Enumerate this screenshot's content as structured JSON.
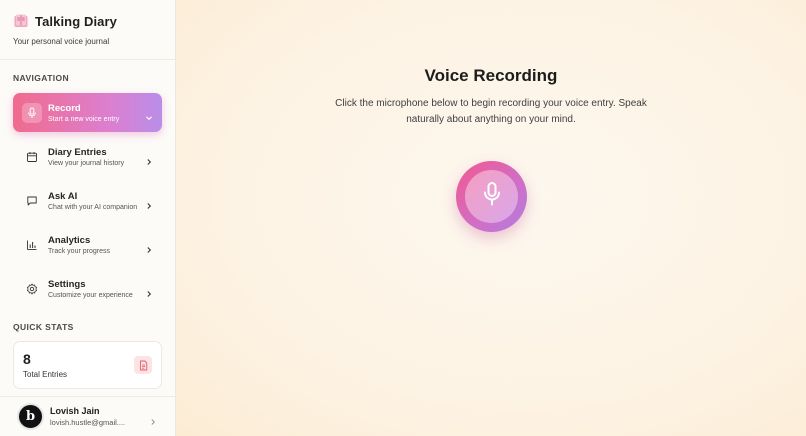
{
  "brand": {
    "title": "Talking Diary",
    "subtitle": "Your personal voice journal",
    "logo_icon": "book-icon"
  },
  "navigation": {
    "title": "NAVIGATION",
    "items": [
      {
        "label": "Record",
        "description": "Start a new voice entry",
        "icon": "microphone-icon",
        "active": true
      },
      {
        "label": "Diary Entries",
        "description": "View your journal history",
        "icon": "calendar-icon",
        "active": false
      },
      {
        "label": "Ask AI",
        "description": "Chat with your AI companion",
        "icon": "chat-icon",
        "active": false
      },
      {
        "label": "Analytics",
        "description": "Track your progress",
        "icon": "bar-chart-icon",
        "active": false
      },
      {
        "label": "Settings",
        "description": "Customize your experience",
        "icon": "gear-icon",
        "active": false
      }
    ]
  },
  "quick_stats": {
    "title": "QUICK STATS",
    "total_entries_value": "8",
    "total_entries_label": "Total Entries",
    "icon": "document-icon"
  },
  "user": {
    "name": "Lovish Jain",
    "email": "lovish.hustle@gmail....",
    "avatar_letter": "b"
  },
  "main": {
    "title": "Voice Recording",
    "description": "Click the microphone below to begin recording your voice entry. Speak naturally about anything on your mind.",
    "record_button_icon": "microphone-icon"
  },
  "colors": {
    "accent_pink": "#f06b8d",
    "accent_purple": "#b98ee8",
    "background": "#fdf3e3"
  }
}
